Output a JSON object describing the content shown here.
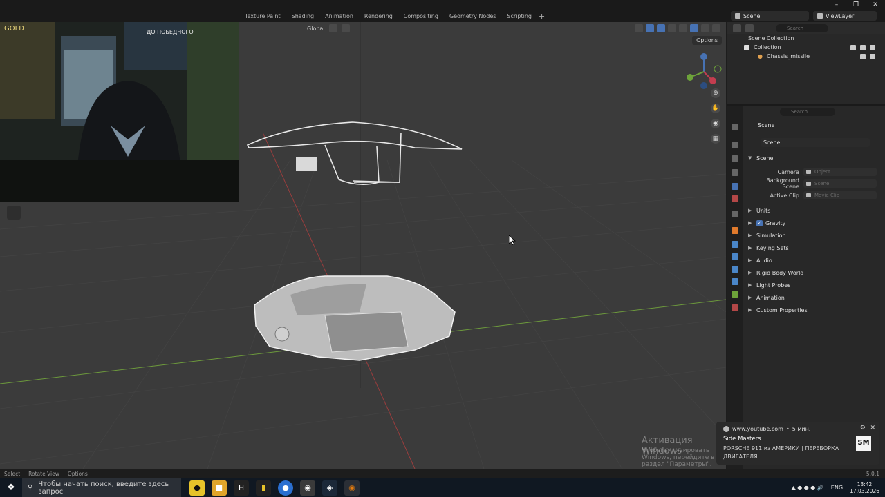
{
  "topbar": {
    "tabs": [
      "Texture Paint",
      "Shading",
      "Animation",
      "Rendering",
      "Compositing",
      "Geometry Nodes",
      "Scripting"
    ],
    "add_tab": "+",
    "scene": "Scene",
    "view_layer": "ViewLayer"
  },
  "viewport": {
    "orientation": "Global",
    "options_label": "Options"
  },
  "webcam": {
    "sign_text": "GOLD",
    "banner_text": "ДО ПОБЕДНОГО"
  },
  "outliner": {
    "search_placeholder": "Search",
    "root": "Scene Collection",
    "collection": "Collection",
    "object": "Chassis_missile"
  },
  "properties": {
    "search_placeholder": "Search",
    "context_title": "Scene",
    "scene_field": "Scene",
    "scene_panel": "Scene",
    "camera_label": "Camera",
    "camera_placeholder": "Object",
    "bg_scene_label": "Background Scene",
    "bg_scene_placeholder": "Scene",
    "active_clip_label": "Active Clip",
    "active_clip_placeholder": "Movie Clip",
    "panels": [
      "Units",
      "Gravity",
      "Simulation",
      "Keying Sets",
      "Audio",
      "Rigid Body World",
      "Light Probes",
      "Animation",
      "Custom Properties"
    ],
    "gravity_checked": true
  },
  "watermark": {
    "line1": "Активация Windows",
    "line2": "Чтобы активировать Windows, перейдите в раздел \"Параметры\"."
  },
  "status_bar": {
    "select": "Select",
    "rotate": "Rotate View",
    "options": "Options",
    "version": "5.0.1"
  },
  "notification": {
    "source": "www.youtube.com",
    "age": "5 мин.",
    "title": "Side Masters",
    "body": "PORSCHE 911 из АМЕРИКИ | ПЕРЕБОРКА ДВИГАТЕЛЯ",
    "logo": "SM"
  },
  "taskbar": {
    "search_placeholder": "Чтобы начать поиск, введите здесь запрос",
    "lang": "ENG",
    "time": "13:42",
    "date": "17.03.2026"
  }
}
